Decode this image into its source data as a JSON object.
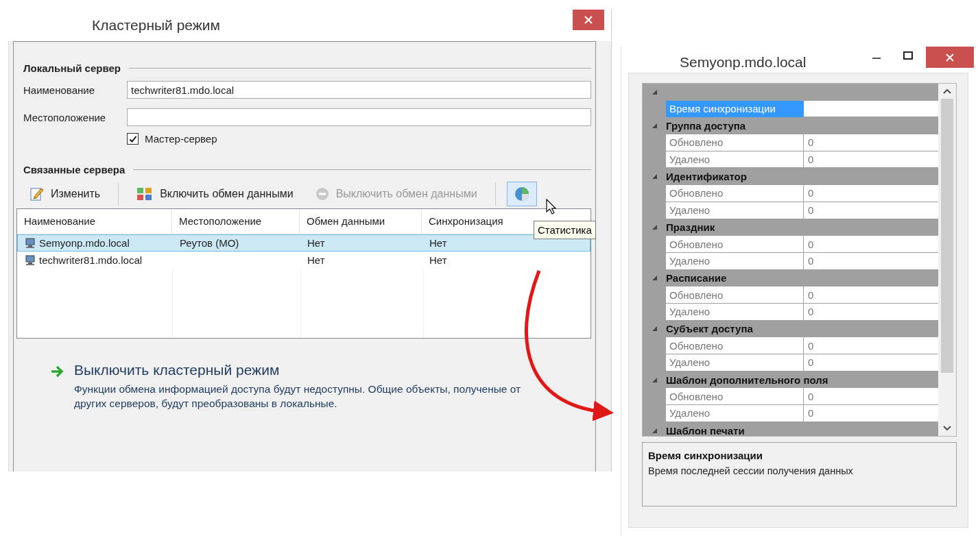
{
  "dialog": {
    "title": "Кластерный режим",
    "local_server": {
      "heading": "Локальный сервер",
      "fields": [
        {
          "label": "Наименование",
          "value": "techwriter81.mdo.local"
        },
        {
          "label": "Местоположение"
        }
      ],
      "master": {
        "label": "Мастер-сервер",
        "checked": true
      }
    },
    "linked_servers": {
      "heading": "Связанные сервера",
      "toolbar": [
        {
          "kind": "edit",
          "label": "Изменить",
          "disabled": false,
          "hovered": false
        },
        {
          "kind": "enable",
          "label": "Включить обмен данными",
          "disabled": false,
          "hovered": false
        },
        {
          "kind": "disable",
          "label": "Выключить обмен данными",
          "disabled": true,
          "hovered": false
        },
        {
          "kind": "stats",
          "disabled": false,
          "hovered": true
        }
      ],
      "tooltip": "Статистика",
      "table": {
        "columns": [
          "Наименование",
          "Местоположение",
          "Обмен данными",
          "Синхронизация"
        ],
        "rows": [
          {
            "cells": [
              "Semyonp.mdo.local",
              "Реутов (МО)",
              "Нет",
              "Нет"
            ],
            "selected": true
          },
          {
            "cells": [
              "techwriter81.mdo.local",
              "",
              "Нет",
              "Нет"
            ],
            "selected": false
          }
        ]
      }
    },
    "action": {
      "title": "Выключить кластерный режим",
      "description": "Функции обмена информацией доступа будут недоступны. Общие объекты, полученые от других серверов, будут преобразованы в локальные."
    }
  },
  "stats_window": {
    "title": "Semyonp.mdo.local",
    "categories": [
      {
        "expanded": true,
        "properties": [
          {
            "name": "Время синхронизации",
            "selected": true
          }
        ]
      },
      {
        "name": "Группа доступа",
        "expanded": true,
        "properties": [
          {
            "name": "Обновлено",
            "value": "0",
            "selected": false
          },
          {
            "name": "Удалено",
            "value": "0",
            "selected": false
          }
        ]
      },
      {
        "name": "Идентификатор",
        "expanded": true,
        "properties": [
          {
            "name": "Обновлено",
            "value": "0",
            "selected": false
          },
          {
            "name": "Удалено",
            "value": "0",
            "selected": false
          }
        ]
      },
      {
        "name": "Праздник",
        "expanded": true,
        "properties": [
          {
            "name": "Обновлено",
            "value": "0",
            "selected": false
          },
          {
            "name": "Удалено",
            "value": "0",
            "selected": false
          }
        ]
      },
      {
        "name": "Расписание",
        "expanded": true,
        "properties": [
          {
            "name": "Обновлено",
            "value": "0",
            "selected": false
          },
          {
            "name": "Удалено",
            "value": "0",
            "selected": false
          }
        ]
      },
      {
        "name": "Субъект доступа",
        "expanded": true,
        "properties": [
          {
            "name": "Обновлено",
            "value": "0",
            "selected": false
          },
          {
            "name": "Удалено",
            "value": "0",
            "selected": false
          }
        ]
      },
      {
        "name": "Шаблон дополнительного поля",
        "expanded": true,
        "properties": [
          {
            "name": "Обновлено",
            "value": "0",
            "selected": false
          },
          {
            "name": "Удалено",
            "value": "0",
            "selected": false
          }
        ]
      },
      {
        "name": "Шаблон печати",
        "expanded": true
      }
    ],
    "description": {
      "title": "Время синхронизации",
      "text": "Время последней сессии получения данных"
    }
  }
}
